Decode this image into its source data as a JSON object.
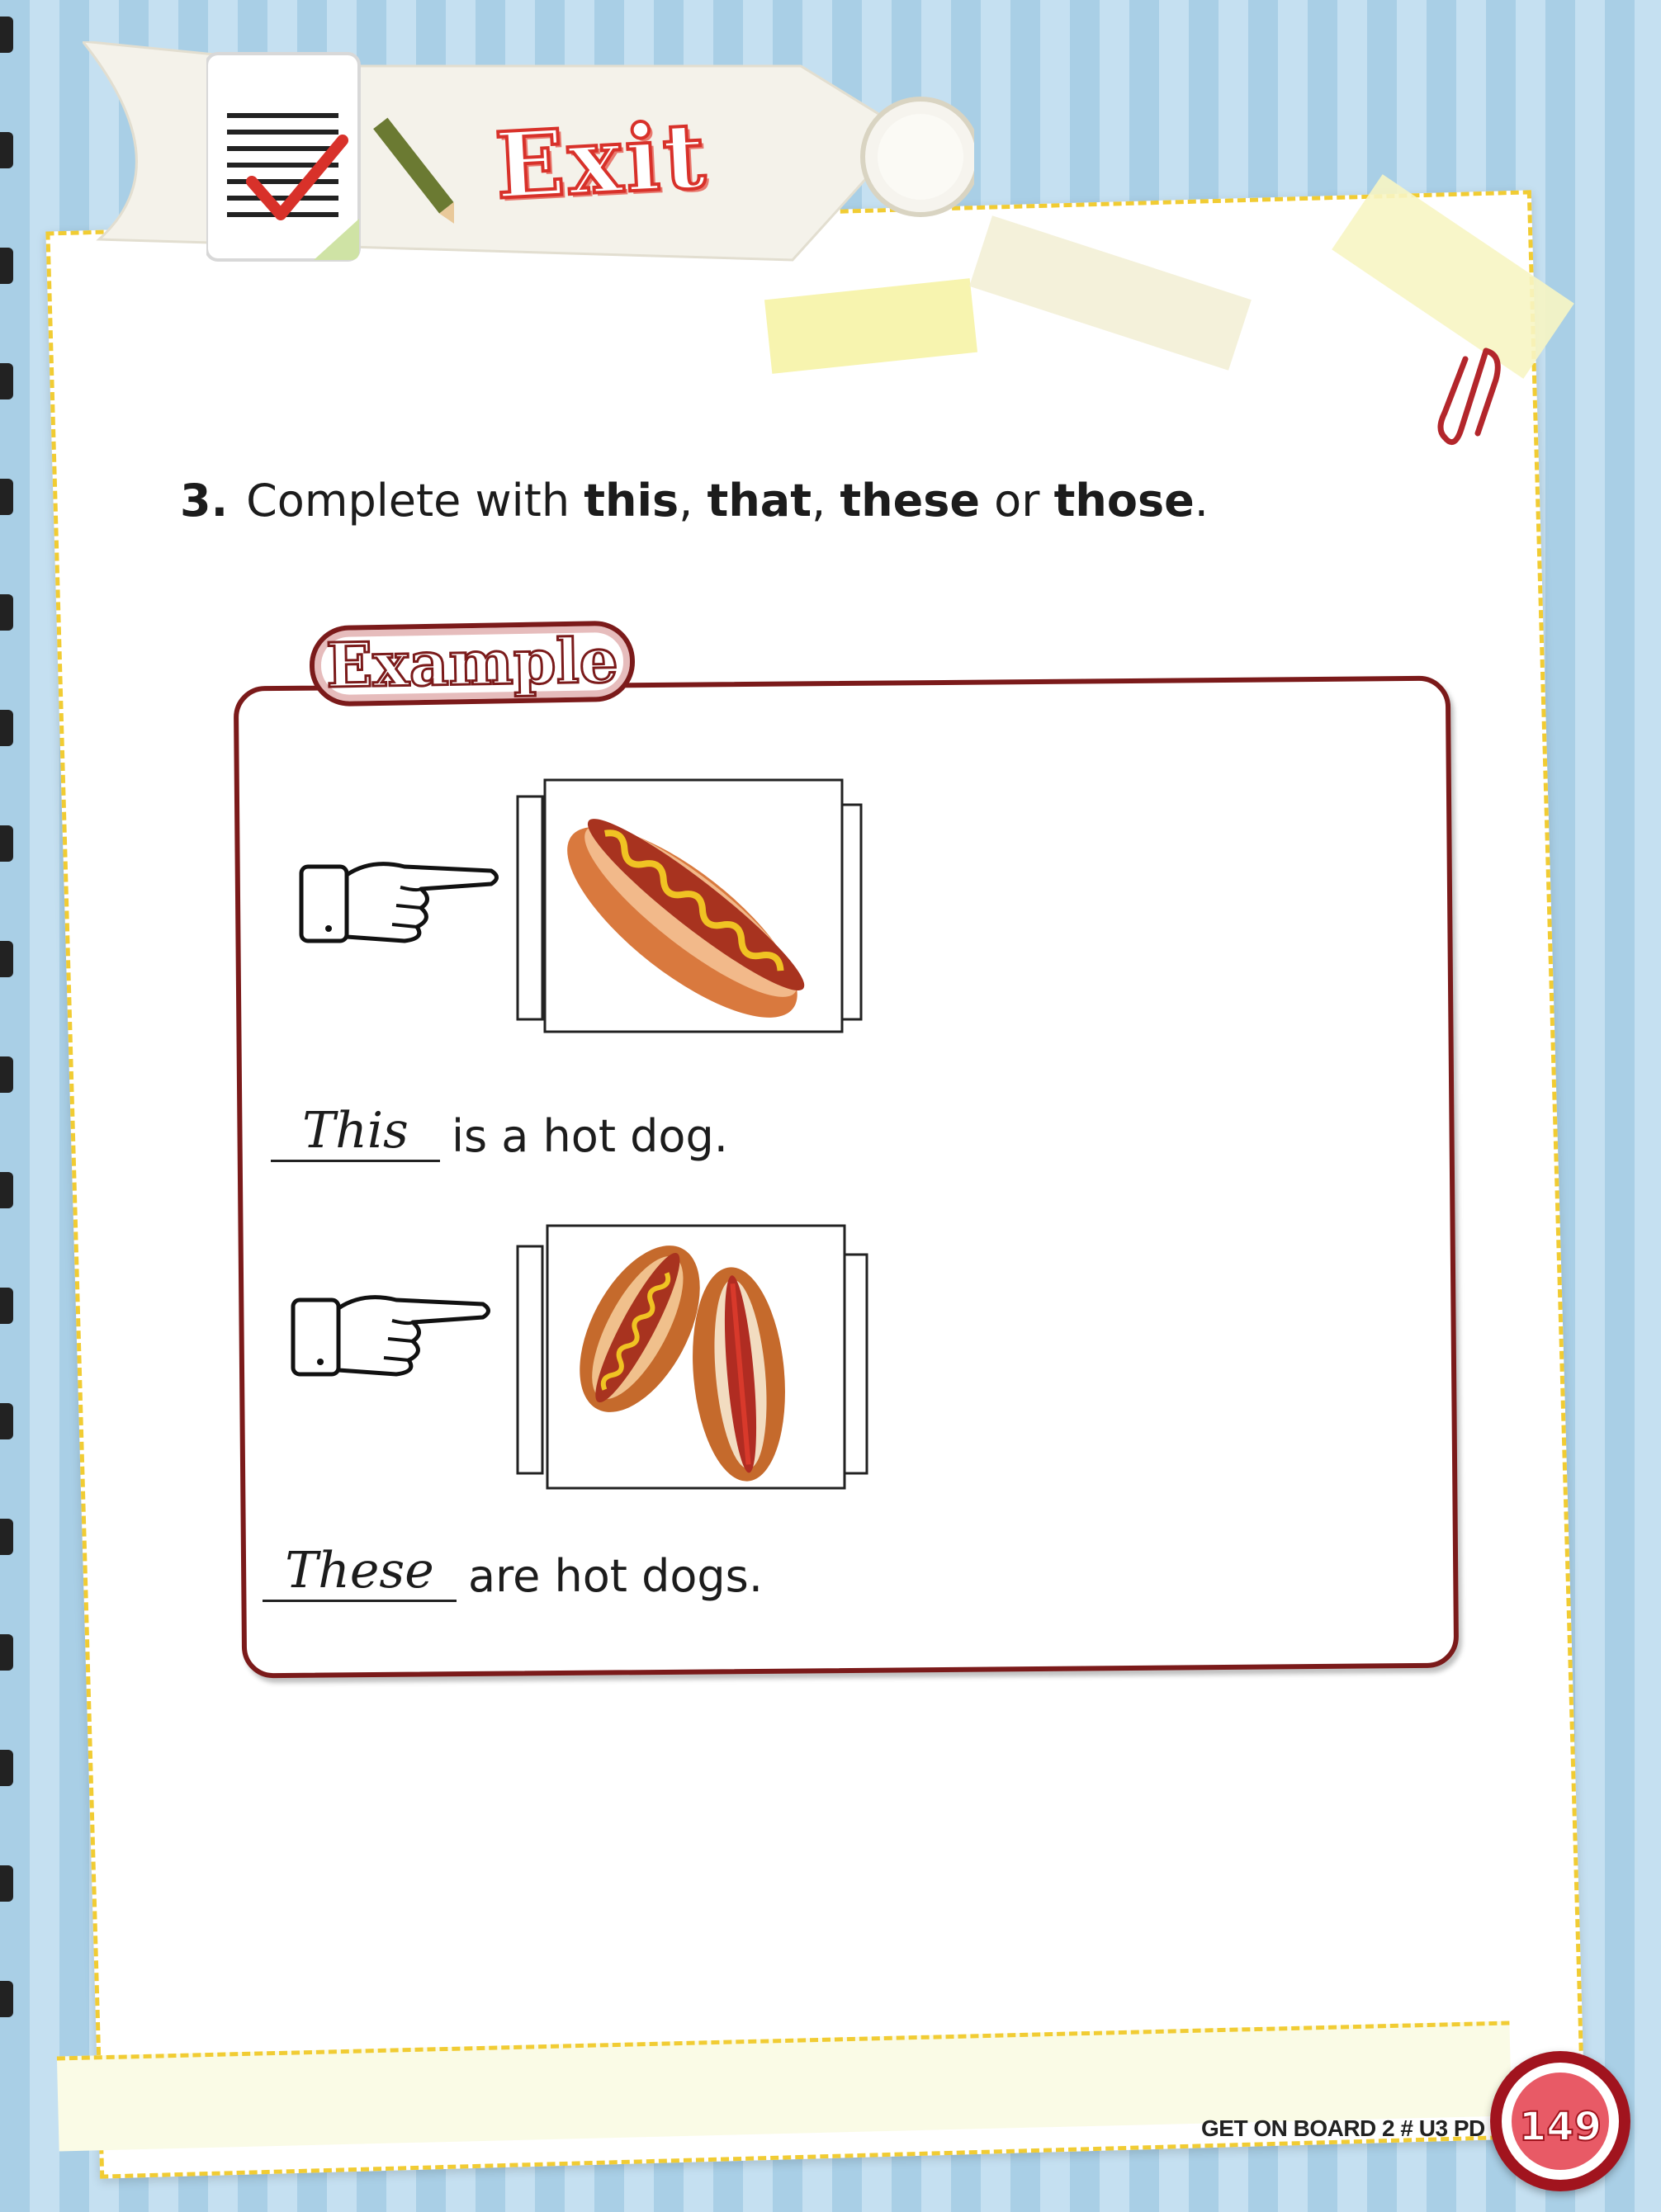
{
  "header": {
    "title": "Exit"
  },
  "exercise": {
    "number": "3.",
    "instruction_start": "Complete with ",
    "words": [
      "this",
      "that",
      "these",
      "those"
    ],
    "sep1": ", ",
    "sep2": ", ",
    "sep3": " or ",
    "end": "."
  },
  "example": {
    "badge": "Example",
    "items": [
      {
        "answer": "This",
        "rest": "is a hot dog.",
        "image": "single-hot-dog"
      },
      {
        "answer": "These",
        "rest": "are hot dogs.",
        "image": "two-hot-dogs"
      }
    ]
  },
  "footer": {
    "text": "GET ON BOARD 2 # U3 PD",
    "page": "149"
  },
  "colors": {
    "accent_red": "#d8312a",
    "box_border": "#7b1a1a",
    "dashed_border": "#f1cc33",
    "badge_red": "#a1141e"
  }
}
